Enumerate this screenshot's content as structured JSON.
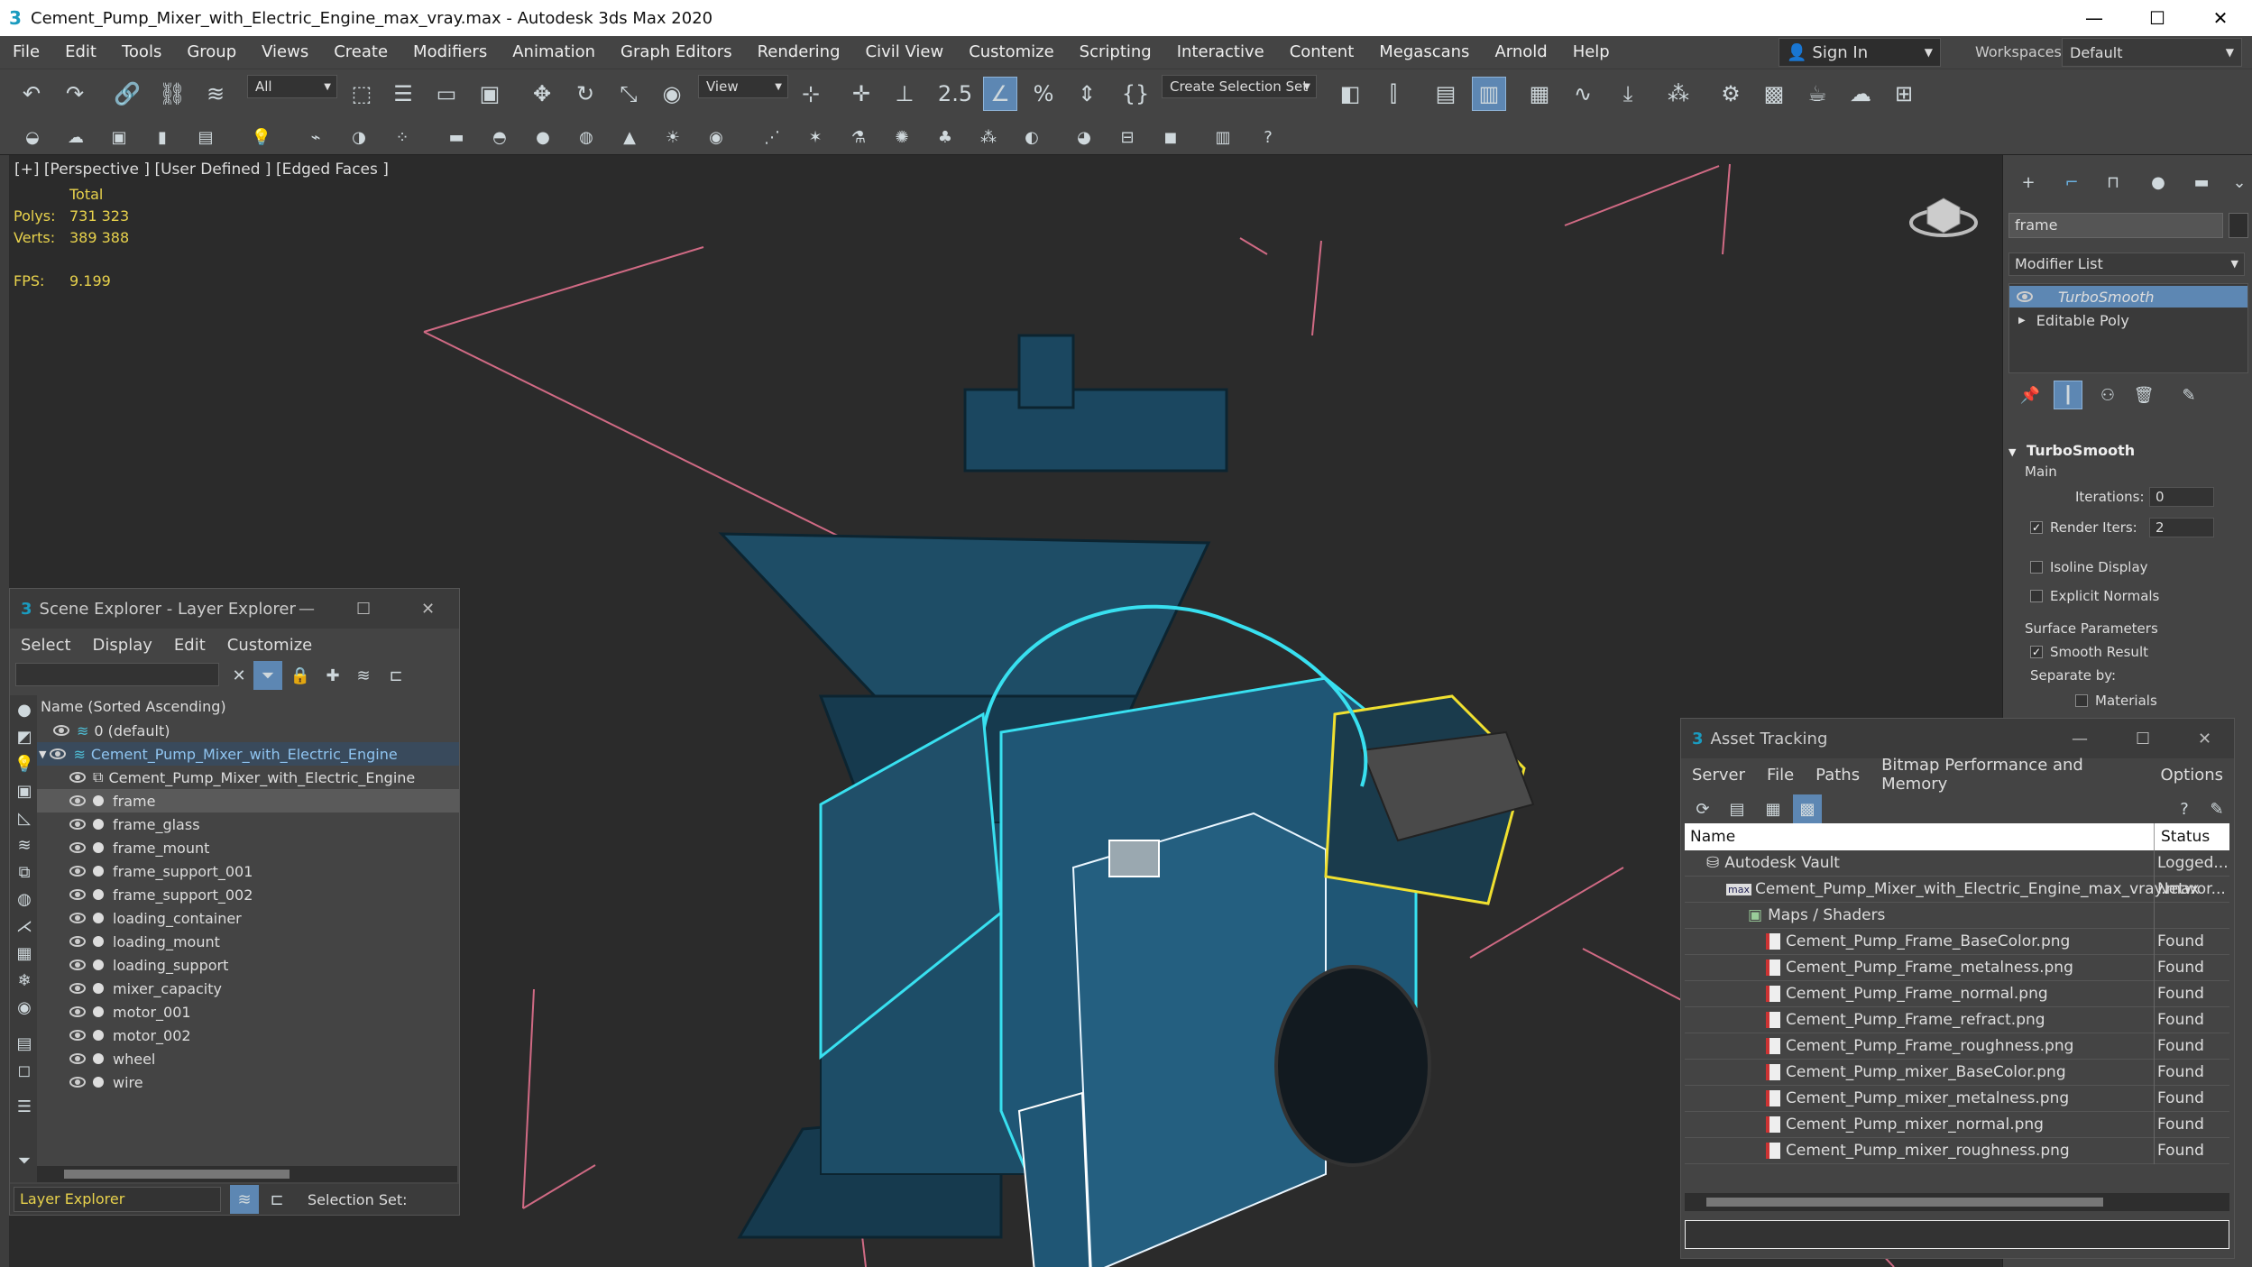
{
  "window": {
    "title": "Cement_Pump_Mixer_with_Electric_Engine_max_vray.max - Autodesk 3ds Max 2020",
    "minimize": "—",
    "maximize": "☐",
    "close": "✕"
  },
  "menu": [
    "File",
    "Edit",
    "Tools",
    "Group",
    "Views",
    "Create",
    "Modifiers",
    "Animation",
    "Graph Editors",
    "Rendering",
    "Civil View",
    "Customize",
    "Scripting",
    "Interactive",
    "Content",
    "Megascans",
    "Arnold",
    "Help"
  ],
  "signin": {
    "label": "Sign In"
  },
  "workspaces": {
    "label": "Workspaces:",
    "value": "Default"
  },
  "toolbar": {
    "filter_dropdown": "All",
    "view_dropdown": "View",
    "selection_set": "Create Selection Set"
  },
  "viewport": {
    "label": "[+] [Perspective ] [User Defined ] [Edged Faces ]",
    "stats": {
      "total_label": "Total",
      "polys_label": "Polys:",
      "polys_value": "731 323",
      "verts_label": "Verts:",
      "verts_value": "389 388",
      "fps_label": "FPS:",
      "fps_value": "9.199"
    }
  },
  "scene_explorer": {
    "title": "Scene Explorer - Layer Explorer",
    "menu": [
      "Select",
      "Display",
      "Edit",
      "Customize"
    ],
    "column_header": "Name (Sorted Ascending)",
    "layer_default": "0 (default)",
    "root": "Cement_Pump_Mixer_with_Electric_Engine",
    "child_group": "Cement_Pump_Mixer_with_Electric_Engine",
    "objects": [
      "frame",
      "frame_glass",
      "frame_mount",
      "frame_support_001",
      "frame_support_002",
      "loading_container",
      "loading_mount",
      "loading_support",
      "mixer_capacity",
      "motor_001",
      "motor_002",
      "wheel",
      "wire"
    ],
    "footer_layer": "Layer Explorer",
    "footer_selection": "Selection Set:"
  },
  "command_panel": {
    "object_name": "frame",
    "modifier_list": "Modifier List",
    "stack": [
      "TurboSmooth",
      "Editable Poly"
    ],
    "rollout_title": "TurboSmooth",
    "main_label": "Main",
    "iterations_label": "Iterations:",
    "iterations_value": "0",
    "render_iters_label": "Render Iters:",
    "render_iters_value": "2",
    "isoline": "Isoline Display",
    "explicit_normals": "Explicit Normals",
    "surface_params": "Surface Parameters",
    "smooth_result": "Smooth Result",
    "separate_by": "Separate by:",
    "materials": "Materials"
  },
  "asset_tracking": {
    "title": "Asset Tracking",
    "menu": [
      "Server",
      "File",
      "Paths",
      "Bitmap Performance and Memory",
      "Options"
    ],
    "col_name": "Name",
    "col_status": "Status",
    "rows": [
      {
        "name": "Autodesk Vault",
        "status": "Logged...",
        "indent": 0
      },
      {
        "name": "Cement_Pump_Mixer_with_Electric_Engine_max_vray.max",
        "status": "Networ...",
        "indent": 1
      },
      {
        "name": "Maps / Shaders",
        "status": "",
        "indent": 2
      },
      {
        "name": "Cement_Pump_Frame_BaseColor.png",
        "status": "Found",
        "indent": 3
      },
      {
        "name": "Cement_Pump_Frame_metalness.png",
        "status": "Found",
        "indent": 3
      },
      {
        "name": "Cement_Pump_Frame_normal.png",
        "status": "Found",
        "indent": 3
      },
      {
        "name": "Cement_Pump_Frame_refract.png",
        "status": "Found",
        "indent": 3
      },
      {
        "name": "Cement_Pump_Frame_roughness.png",
        "status": "Found",
        "indent": 3
      },
      {
        "name": "Cement_Pump_mixer_BaseColor.png",
        "status": "Found",
        "indent": 3
      },
      {
        "name": "Cement_Pump_mixer_metalness.png",
        "status": "Found",
        "indent": 3
      },
      {
        "name": "Cement_Pump_mixer_normal.png",
        "status": "Found",
        "indent": 3
      },
      {
        "name": "Cement_Pump_mixer_roughness.png",
        "status": "Found",
        "indent": 3
      }
    ]
  },
  "colors": {
    "selection_cyan": "#38e0f0",
    "selection_yellow": "#f0e030",
    "model_blue": "#1e5573",
    "bbox_pink": "#e07890",
    "stats_yellow": "#e8d24c",
    "highlight_blue": "#4a90d9"
  }
}
